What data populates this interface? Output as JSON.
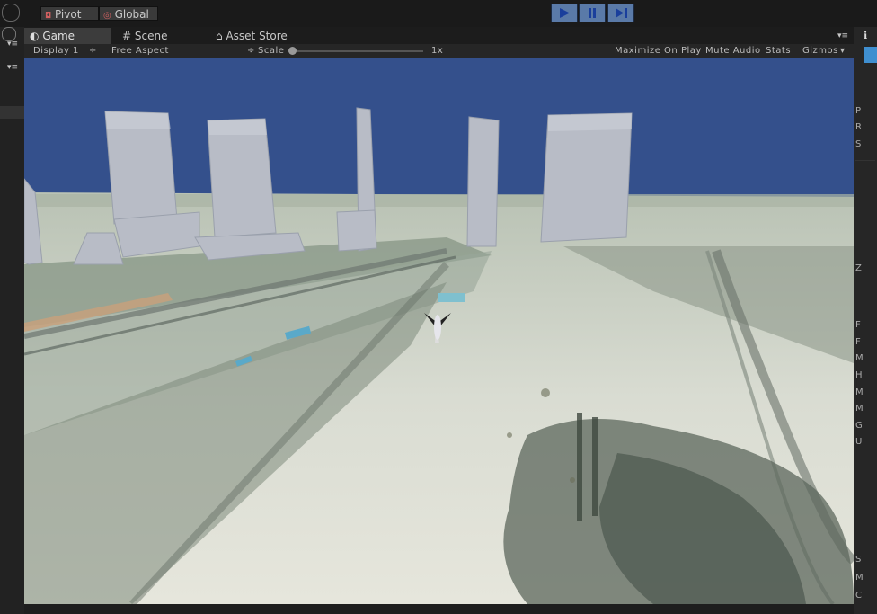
{
  "toolbar": {
    "pivot_label": "Pivot",
    "global_label": "Global"
  },
  "tabs": [
    {
      "label": "Game",
      "active": true
    },
    {
      "label": "Scene",
      "active": false
    },
    {
      "label": "Asset Store",
      "active": false
    }
  ],
  "game_bar": {
    "display": "Display 1",
    "aspect": "Free Aspect",
    "scale_label": "Scale",
    "scale_value": "1x",
    "maximize": "Maximize On Play",
    "mute": "Mute Audio",
    "stats": "Stats",
    "gizmos": "Gizmos"
  },
  "inspector_glyphs": [
    "P",
    "R",
    "S",
    "Z",
    "F",
    "F",
    "M",
    "H",
    "M",
    "M",
    "G",
    "U",
    "S",
    "M",
    "C"
  ],
  "colors": {
    "sky": "#34508c",
    "play_active": "#5a7aa8"
  }
}
